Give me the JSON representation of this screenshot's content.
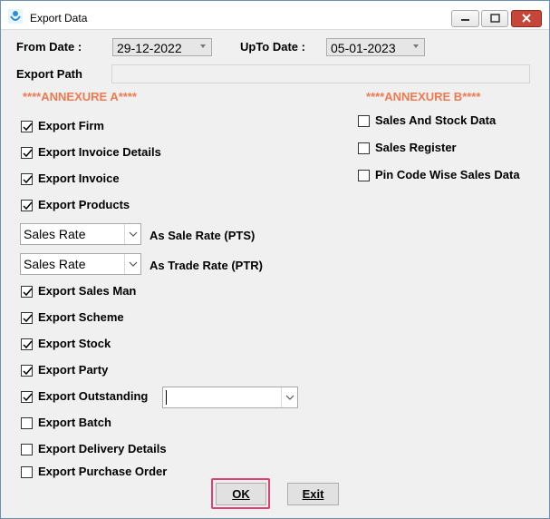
{
  "window": {
    "title": "Export Data"
  },
  "dates": {
    "from_label": "From Date :",
    "from_value": "29-12-2022",
    "upto_label": "UpTo Date :",
    "upto_value": "05-01-2023"
  },
  "export_path": {
    "label": "Export Path",
    "value": ""
  },
  "annexure_a": {
    "heading": "****ANNEXURE A****",
    "export_firm": "Export Firm",
    "export_invoice_details": "Export Invoice Details",
    "export_invoice": "Export Invoice",
    "export_products": "Export Products",
    "sale_rate_select": "Sales Rate",
    "sale_rate_label": "As Sale Rate (PTS)",
    "trade_rate_select": "Sales Rate",
    "trade_rate_label": "As Trade Rate (PTR)",
    "export_sales_man": "Export Sales Man",
    "export_scheme": "Export Scheme",
    "export_stock": "Export Stock",
    "export_party": "Export Party",
    "export_outstanding": "Export Outstanding",
    "outstanding_select": "",
    "export_batch": "Export Batch",
    "export_delivery_details": "Export Delivery Details",
    "export_purchase_order": "Export Purchase Order"
  },
  "annexure_b": {
    "heading": "****ANNEXURE B****",
    "sales_and_stock": "Sales And Stock Data",
    "sales_register": "Sales Register",
    "pin_code_wise": "Pin Code Wise Sales Data"
  },
  "buttons": {
    "ok": "OK",
    "exit": "Exit"
  },
  "colors": {
    "annexure_heading": "#f07a50",
    "ok_focus_border": "#e04070"
  }
}
